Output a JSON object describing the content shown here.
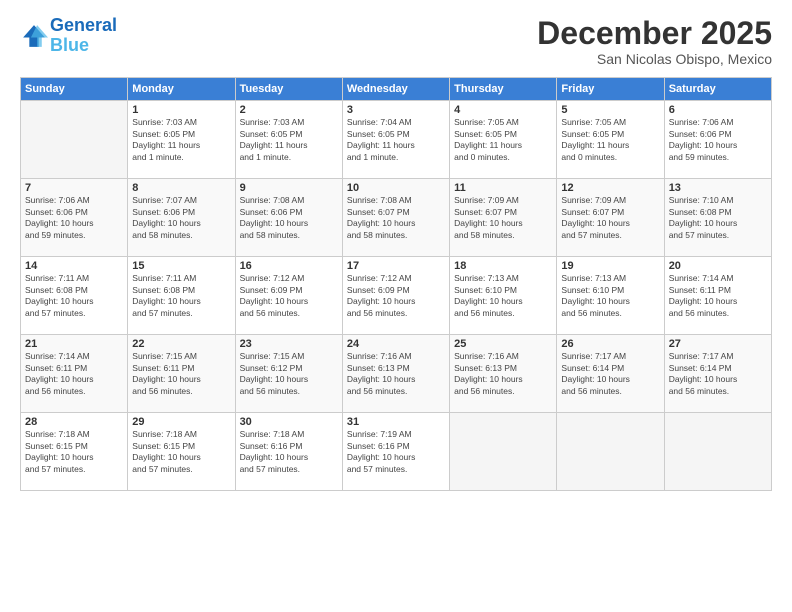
{
  "logo": {
    "line1": "General",
    "line2": "Blue"
  },
  "title": "December 2025",
  "location": "San Nicolas Obispo, Mexico",
  "days_header": [
    "Sunday",
    "Monday",
    "Tuesday",
    "Wednesday",
    "Thursday",
    "Friday",
    "Saturday"
  ],
  "weeks": [
    [
      {
        "num": "",
        "info": ""
      },
      {
        "num": "1",
        "info": "Sunrise: 7:03 AM\nSunset: 6:05 PM\nDaylight: 11 hours\nand 1 minute."
      },
      {
        "num": "2",
        "info": "Sunrise: 7:03 AM\nSunset: 6:05 PM\nDaylight: 11 hours\nand 1 minute."
      },
      {
        "num": "3",
        "info": "Sunrise: 7:04 AM\nSunset: 6:05 PM\nDaylight: 11 hours\nand 1 minute."
      },
      {
        "num": "4",
        "info": "Sunrise: 7:05 AM\nSunset: 6:05 PM\nDaylight: 11 hours\nand 0 minutes."
      },
      {
        "num": "5",
        "info": "Sunrise: 7:05 AM\nSunset: 6:05 PM\nDaylight: 11 hours\nand 0 minutes."
      },
      {
        "num": "6",
        "info": "Sunrise: 7:06 AM\nSunset: 6:06 PM\nDaylight: 10 hours\nand 59 minutes."
      }
    ],
    [
      {
        "num": "7",
        "info": "Sunrise: 7:06 AM\nSunset: 6:06 PM\nDaylight: 10 hours\nand 59 minutes."
      },
      {
        "num": "8",
        "info": "Sunrise: 7:07 AM\nSunset: 6:06 PM\nDaylight: 10 hours\nand 58 minutes."
      },
      {
        "num": "9",
        "info": "Sunrise: 7:08 AM\nSunset: 6:06 PM\nDaylight: 10 hours\nand 58 minutes."
      },
      {
        "num": "10",
        "info": "Sunrise: 7:08 AM\nSunset: 6:07 PM\nDaylight: 10 hours\nand 58 minutes."
      },
      {
        "num": "11",
        "info": "Sunrise: 7:09 AM\nSunset: 6:07 PM\nDaylight: 10 hours\nand 58 minutes."
      },
      {
        "num": "12",
        "info": "Sunrise: 7:09 AM\nSunset: 6:07 PM\nDaylight: 10 hours\nand 57 minutes."
      },
      {
        "num": "13",
        "info": "Sunrise: 7:10 AM\nSunset: 6:08 PM\nDaylight: 10 hours\nand 57 minutes."
      }
    ],
    [
      {
        "num": "14",
        "info": "Sunrise: 7:11 AM\nSunset: 6:08 PM\nDaylight: 10 hours\nand 57 minutes."
      },
      {
        "num": "15",
        "info": "Sunrise: 7:11 AM\nSunset: 6:08 PM\nDaylight: 10 hours\nand 57 minutes."
      },
      {
        "num": "16",
        "info": "Sunrise: 7:12 AM\nSunset: 6:09 PM\nDaylight: 10 hours\nand 56 minutes."
      },
      {
        "num": "17",
        "info": "Sunrise: 7:12 AM\nSunset: 6:09 PM\nDaylight: 10 hours\nand 56 minutes."
      },
      {
        "num": "18",
        "info": "Sunrise: 7:13 AM\nSunset: 6:10 PM\nDaylight: 10 hours\nand 56 minutes."
      },
      {
        "num": "19",
        "info": "Sunrise: 7:13 AM\nSunset: 6:10 PM\nDaylight: 10 hours\nand 56 minutes."
      },
      {
        "num": "20",
        "info": "Sunrise: 7:14 AM\nSunset: 6:11 PM\nDaylight: 10 hours\nand 56 minutes."
      }
    ],
    [
      {
        "num": "21",
        "info": "Sunrise: 7:14 AM\nSunset: 6:11 PM\nDaylight: 10 hours\nand 56 minutes."
      },
      {
        "num": "22",
        "info": "Sunrise: 7:15 AM\nSunset: 6:11 PM\nDaylight: 10 hours\nand 56 minutes."
      },
      {
        "num": "23",
        "info": "Sunrise: 7:15 AM\nSunset: 6:12 PM\nDaylight: 10 hours\nand 56 minutes."
      },
      {
        "num": "24",
        "info": "Sunrise: 7:16 AM\nSunset: 6:13 PM\nDaylight: 10 hours\nand 56 minutes."
      },
      {
        "num": "25",
        "info": "Sunrise: 7:16 AM\nSunset: 6:13 PM\nDaylight: 10 hours\nand 56 minutes."
      },
      {
        "num": "26",
        "info": "Sunrise: 7:17 AM\nSunset: 6:14 PM\nDaylight: 10 hours\nand 56 minutes."
      },
      {
        "num": "27",
        "info": "Sunrise: 7:17 AM\nSunset: 6:14 PM\nDaylight: 10 hours\nand 56 minutes."
      }
    ],
    [
      {
        "num": "28",
        "info": "Sunrise: 7:18 AM\nSunset: 6:15 PM\nDaylight: 10 hours\nand 57 minutes."
      },
      {
        "num": "29",
        "info": "Sunrise: 7:18 AM\nSunset: 6:15 PM\nDaylight: 10 hours\nand 57 minutes."
      },
      {
        "num": "30",
        "info": "Sunrise: 7:18 AM\nSunset: 6:16 PM\nDaylight: 10 hours\nand 57 minutes."
      },
      {
        "num": "31",
        "info": "Sunrise: 7:19 AM\nSunset: 6:16 PM\nDaylight: 10 hours\nand 57 minutes."
      },
      {
        "num": "",
        "info": ""
      },
      {
        "num": "",
        "info": ""
      },
      {
        "num": "",
        "info": ""
      }
    ]
  ]
}
